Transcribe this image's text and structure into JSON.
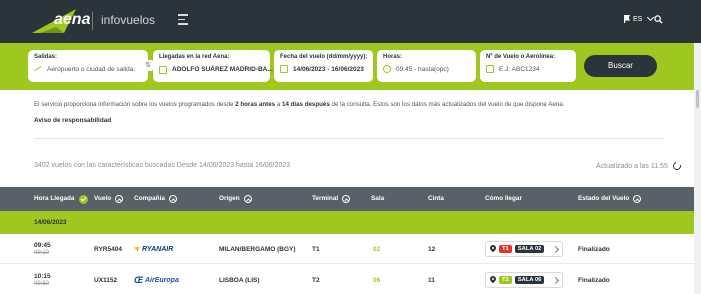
{
  "header": {
    "logo_text": "aena",
    "brand_sub": "infovuelos",
    "language": "ES",
    "colors": {
      "topbar": "#2b333b",
      "accent": "#9ec71f"
    }
  },
  "search": {
    "salidas": {
      "label": "Salidas:",
      "placeholder": "Aeropuerto o ciudad de salida:"
    },
    "llegadas": {
      "label": "Llegadas en la red Aena:",
      "value": "ADOLFO SUÁREZ MADRID-BA..."
    },
    "fecha": {
      "label": "Fecha del vuelo (dd/mm/yyyy):",
      "value": "14/06/2023 - 16/06/2023"
    },
    "horas": {
      "label": "Horas:",
      "value": "09:45 - hasta(opc)"
    },
    "vuelo": {
      "label": "Nº de Vuelo o Aerolínea:",
      "placeholder": "E.J: ABC1234"
    },
    "button": "Buscar"
  },
  "info": {
    "pre": "El servicio proporciona información sobre los vuelos programados desde ",
    "hours_before": "2 horas antes",
    "mid": " a ",
    "days_after": "14 días después",
    "post": " de la consulta. Estos son los datos más actualizados del vuelo de que dispone Aena.",
    "disclaimer": "Aviso de responsabilidad"
  },
  "results": {
    "count_text": "3402 vuelos con las características buscadas Desde 14/06/2023 hasta 16/06/2023",
    "updated_text": "Actualizado a las 11:55"
  },
  "table": {
    "headers": [
      "Hora Llegada",
      "Vuelo",
      "Compañía",
      "Origen",
      "Terminal",
      "Sala",
      "Cinta",
      "Cómo llegar",
      "Estado del Vuelo"
    ],
    "date_band": "14/06/2023",
    "rows": [
      {
        "time": "09:45",
        "scheduled": "09:10",
        "flight": "RYR5404",
        "airline": "RYANAIR",
        "origin": "MILAN/BERGAMO (BGY)",
        "terminal": "T1",
        "sala": "02",
        "cinta": "12",
        "how_terminal": "T1",
        "how_sala": "SALA 02",
        "status": "Finalizado"
      },
      {
        "time": "10:15",
        "scheduled": "09:50",
        "flight": "UX1152",
        "airline": "AirEuropa",
        "origin": "LISBOA (LIS)",
        "terminal": "T2",
        "sala": "06",
        "cinta": "11",
        "how_terminal": "T2",
        "how_sala": "SALA 06",
        "status": "Finalizado"
      }
    ]
  }
}
